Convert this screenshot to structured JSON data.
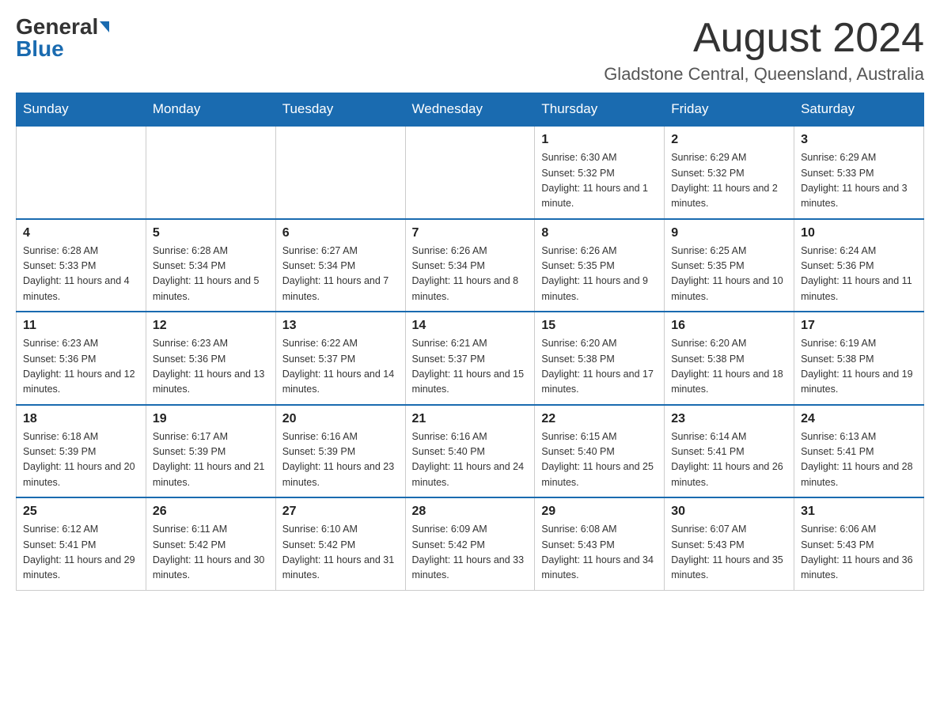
{
  "header": {
    "logo_general": "General",
    "logo_blue": "Blue",
    "month_title": "August 2024",
    "location": "Gladstone Central, Queensland, Australia"
  },
  "days_of_week": [
    "Sunday",
    "Monday",
    "Tuesday",
    "Wednesday",
    "Thursday",
    "Friday",
    "Saturday"
  ],
  "weeks": [
    [
      {
        "day": "",
        "info": ""
      },
      {
        "day": "",
        "info": ""
      },
      {
        "day": "",
        "info": ""
      },
      {
        "day": "",
        "info": ""
      },
      {
        "day": "1",
        "info": "Sunrise: 6:30 AM\nSunset: 5:32 PM\nDaylight: 11 hours and 1 minute."
      },
      {
        "day": "2",
        "info": "Sunrise: 6:29 AM\nSunset: 5:32 PM\nDaylight: 11 hours and 2 minutes."
      },
      {
        "day": "3",
        "info": "Sunrise: 6:29 AM\nSunset: 5:33 PM\nDaylight: 11 hours and 3 minutes."
      }
    ],
    [
      {
        "day": "4",
        "info": "Sunrise: 6:28 AM\nSunset: 5:33 PM\nDaylight: 11 hours and 4 minutes."
      },
      {
        "day": "5",
        "info": "Sunrise: 6:28 AM\nSunset: 5:34 PM\nDaylight: 11 hours and 5 minutes."
      },
      {
        "day": "6",
        "info": "Sunrise: 6:27 AM\nSunset: 5:34 PM\nDaylight: 11 hours and 7 minutes."
      },
      {
        "day": "7",
        "info": "Sunrise: 6:26 AM\nSunset: 5:34 PM\nDaylight: 11 hours and 8 minutes."
      },
      {
        "day": "8",
        "info": "Sunrise: 6:26 AM\nSunset: 5:35 PM\nDaylight: 11 hours and 9 minutes."
      },
      {
        "day": "9",
        "info": "Sunrise: 6:25 AM\nSunset: 5:35 PM\nDaylight: 11 hours and 10 minutes."
      },
      {
        "day": "10",
        "info": "Sunrise: 6:24 AM\nSunset: 5:36 PM\nDaylight: 11 hours and 11 minutes."
      }
    ],
    [
      {
        "day": "11",
        "info": "Sunrise: 6:23 AM\nSunset: 5:36 PM\nDaylight: 11 hours and 12 minutes."
      },
      {
        "day": "12",
        "info": "Sunrise: 6:23 AM\nSunset: 5:36 PM\nDaylight: 11 hours and 13 minutes."
      },
      {
        "day": "13",
        "info": "Sunrise: 6:22 AM\nSunset: 5:37 PM\nDaylight: 11 hours and 14 minutes."
      },
      {
        "day": "14",
        "info": "Sunrise: 6:21 AM\nSunset: 5:37 PM\nDaylight: 11 hours and 15 minutes."
      },
      {
        "day": "15",
        "info": "Sunrise: 6:20 AM\nSunset: 5:38 PM\nDaylight: 11 hours and 17 minutes."
      },
      {
        "day": "16",
        "info": "Sunrise: 6:20 AM\nSunset: 5:38 PM\nDaylight: 11 hours and 18 minutes."
      },
      {
        "day": "17",
        "info": "Sunrise: 6:19 AM\nSunset: 5:38 PM\nDaylight: 11 hours and 19 minutes."
      }
    ],
    [
      {
        "day": "18",
        "info": "Sunrise: 6:18 AM\nSunset: 5:39 PM\nDaylight: 11 hours and 20 minutes."
      },
      {
        "day": "19",
        "info": "Sunrise: 6:17 AM\nSunset: 5:39 PM\nDaylight: 11 hours and 21 minutes."
      },
      {
        "day": "20",
        "info": "Sunrise: 6:16 AM\nSunset: 5:39 PM\nDaylight: 11 hours and 23 minutes."
      },
      {
        "day": "21",
        "info": "Sunrise: 6:16 AM\nSunset: 5:40 PM\nDaylight: 11 hours and 24 minutes."
      },
      {
        "day": "22",
        "info": "Sunrise: 6:15 AM\nSunset: 5:40 PM\nDaylight: 11 hours and 25 minutes."
      },
      {
        "day": "23",
        "info": "Sunrise: 6:14 AM\nSunset: 5:41 PM\nDaylight: 11 hours and 26 minutes."
      },
      {
        "day": "24",
        "info": "Sunrise: 6:13 AM\nSunset: 5:41 PM\nDaylight: 11 hours and 28 minutes."
      }
    ],
    [
      {
        "day": "25",
        "info": "Sunrise: 6:12 AM\nSunset: 5:41 PM\nDaylight: 11 hours and 29 minutes."
      },
      {
        "day": "26",
        "info": "Sunrise: 6:11 AM\nSunset: 5:42 PM\nDaylight: 11 hours and 30 minutes."
      },
      {
        "day": "27",
        "info": "Sunrise: 6:10 AM\nSunset: 5:42 PM\nDaylight: 11 hours and 31 minutes."
      },
      {
        "day": "28",
        "info": "Sunrise: 6:09 AM\nSunset: 5:42 PM\nDaylight: 11 hours and 33 minutes."
      },
      {
        "day": "29",
        "info": "Sunrise: 6:08 AM\nSunset: 5:43 PM\nDaylight: 11 hours and 34 minutes."
      },
      {
        "day": "30",
        "info": "Sunrise: 6:07 AM\nSunset: 5:43 PM\nDaylight: 11 hours and 35 minutes."
      },
      {
        "day": "31",
        "info": "Sunrise: 6:06 AM\nSunset: 5:43 PM\nDaylight: 11 hours and 36 minutes."
      }
    ]
  ]
}
